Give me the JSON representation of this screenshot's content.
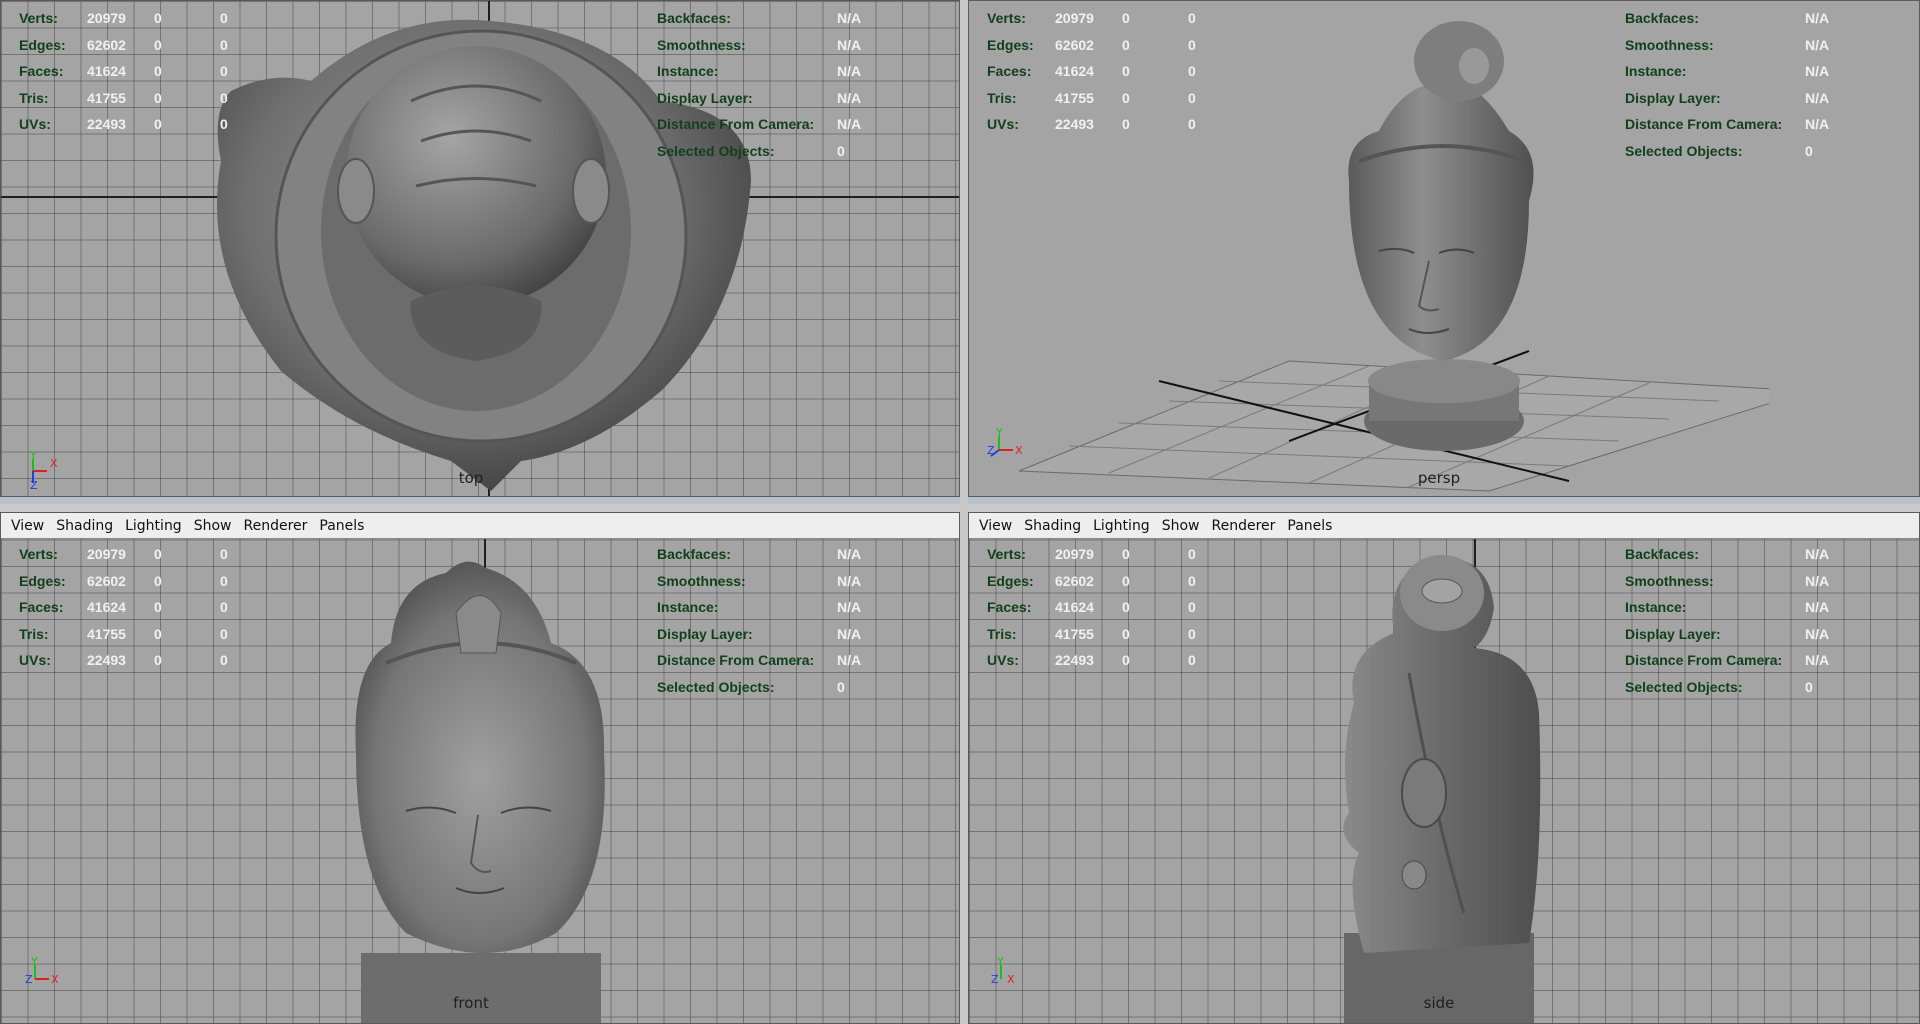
{
  "menu": [
    "View",
    "Shading",
    "Lighting",
    "Show",
    "Renderer",
    "Panels"
  ],
  "stats": [
    {
      "label": "Verts:",
      "v1": "20979",
      "v2": "0",
      "v3": "0"
    },
    {
      "label": "Edges:",
      "v1": "62602",
      "v2": "0",
      "v3": "0"
    },
    {
      "label": "Faces:",
      "v1": "41624",
      "v2": "0",
      "v3": "0"
    },
    {
      "label": "Tris:",
      "v1": "41755",
      "v2": "0",
      "v3": "0"
    },
    {
      "label": "UVs:",
      "v1": "22493",
      "v2": "0",
      "v3": "0"
    }
  ],
  "props": [
    {
      "label": "Backfaces:",
      "value": "N/A"
    },
    {
      "label": "Smoothness:",
      "value": "N/A"
    },
    {
      "label": "Instance:",
      "value": "N/A"
    },
    {
      "label": "Display Layer:",
      "value": "N/A"
    },
    {
      "label": "Distance From Camera:",
      "value": "N/A"
    },
    {
      "label": "Selected Objects:",
      "value": "0"
    }
  ],
  "viewports": [
    {
      "id": "top",
      "camera": "top",
      "menu": false,
      "gizmo": {
        "up": "Y",
        "right": "X",
        "out": "Z"
      }
    },
    {
      "id": "persp",
      "camera": "persp",
      "menu": false,
      "gizmo": {
        "up": "Y",
        "right": "X",
        "out": "Z"
      }
    },
    {
      "id": "front",
      "camera": "front",
      "menu": true,
      "gizmo": {
        "up": "Y",
        "right": "X",
        "out": "Z"
      }
    },
    {
      "id": "side",
      "camera": "side",
      "menu": true,
      "gizmo": {
        "up": "Y",
        "right": "X",
        "out": "Z"
      }
    }
  ],
  "colors": {
    "viewport_bg": "#a4a4a4",
    "hud_label": "#11411a",
    "hud_value": "#f1f1f1",
    "axis_x": "#e02020",
    "axis_y": "#19c019",
    "axis_z": "#1f3fe0",
    "model": "#6e6e6e"
  }
}
